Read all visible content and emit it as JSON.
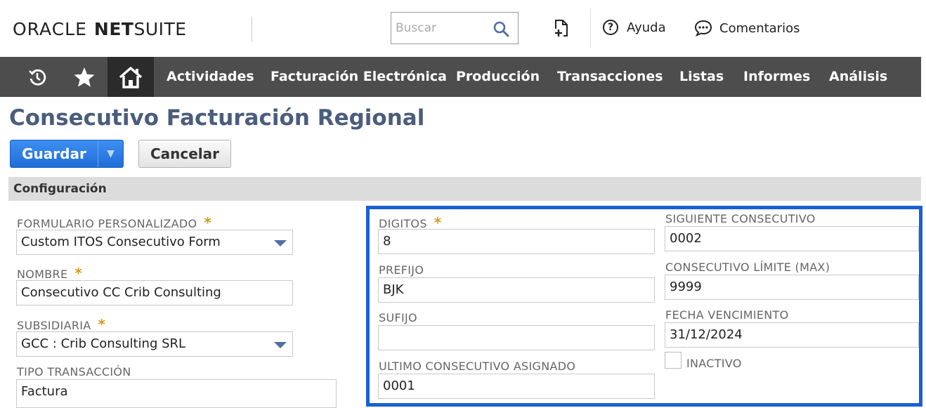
{
  "header": {
    "logo_oracle": "ORACLE",
    "logo_net": "NET",
    "logo_suite": "SUITE",
    "search_placeholder": "Buscar",
    "help_label": "Ayuda",
    "comments_label": "Comentarios"
  },
  "nav": {
    "items": [
      "Actividades",
      "Facturación Electrónica",
      "Producción",
      "Transacciones",
      "Listas",
      "Informes",
      "Análisis"
    ]
  },
  "page": {
    "title": "Consecutivo Facturación Regional",
    "save_label": "Guardar",
    "cancel_label": "Cancelar",
    "section_title": "Configuración"
  },
  "fields": {
    "formulario_label": "FORMULARIO PERSONALIZADO",
    "formulario_value": "Custom ITOS Consecutivo Form",
    "nombre_label": "NOMBRE",
    "nombre_value": "Consecutivo CC Crib Consulting",
    "subsidiaria_label": "SUBSIDIARIA",
    "subsidiaria_value": "GCC : Crib Consulting SRL",
    "tipo_label": "TIPO TRANSACCIÓN",
    "tipo_value": "Factura",
    "digitos_label": "DIGITOS",
    "digitos_value": "8",
    "prefijo_label": "PREFIJO",
    "prefijo_value": "BJK",
    "sufijo_label": "SUFIJO",
    "sufijo_value": "",
    "ultimo_label": "ULTIMO CONSECUTIVO ASIGNADO",
    "ultimo_value": "0001",
    "siguiente_label": "SIGUIENTE CONSECUTIVO",
    "siguiente_value": "0002",
    "limite_label": "CONSECUTIVO LÍMITE (MAX)",
    "limite_value": "9999",
    "fecha_label": "FECHA VENCIMIENTO",
    "fecha_value": "31/12/2024",
    "inactivo_label": "INACTIVO",
    "required_mark": "*"
  },
  "colors": {
    "title": "#4a5d7c",
    "navbar": "#4d4d4d",
    "save_button": "#2a7ce6",
    "required": "#d59a1a",
    "highlight_border": "#1b5fd6"
  },
  "icons": [
    "recent-icon",
    "star-icon",
    "home-icon",
    "search-icon",
    "new-doc-icon",
    "help-icon",
    "comments-icon",
    "dropdown-arrow-icon"
  ]
}
